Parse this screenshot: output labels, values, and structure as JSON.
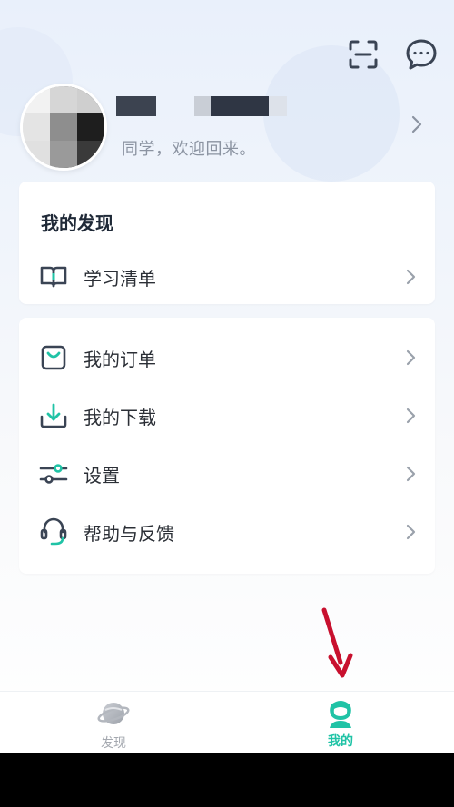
{
  "header": {
    "scan_icon": "scan-icon",
    "message_icon": "chat-bubble-icon"
  },
  "profile": {
    "subtitle": "同学，欢迎回来。"
  },
  "discover": {
    "title": "我的发现",
    "items": [
      {
        "label": "学习清单",
        "icon": "book-icon"
      }
    ]
  },
  "menu": {
    "items": [
      {
        "label": "我的订单",
        "icon": "shopping-bag-icon"
      },
      {
        "label": "我的下载",
        "icon": "download-icon"
      },
      {
        "label": "设置",
        "icon": "sliders-icon"
      },
      {
        "label": "帮助与反馈",
        "icon": "headset-icon"
      }
    ]
  },
  "tabbar": {
    "tabs": [
      {
        "label": "发现",
        "icon": "planet-icon",
        "active": false
      },
      {
        "label": "我的",
        "icon": "user-icon",
        "active": true
      }
    ]
  },
  "colors": {
    "accent": "#20c3a6",
    "icon_dark": "#3a4454",
    "annotation_red": "#c8102e"
  }
}
